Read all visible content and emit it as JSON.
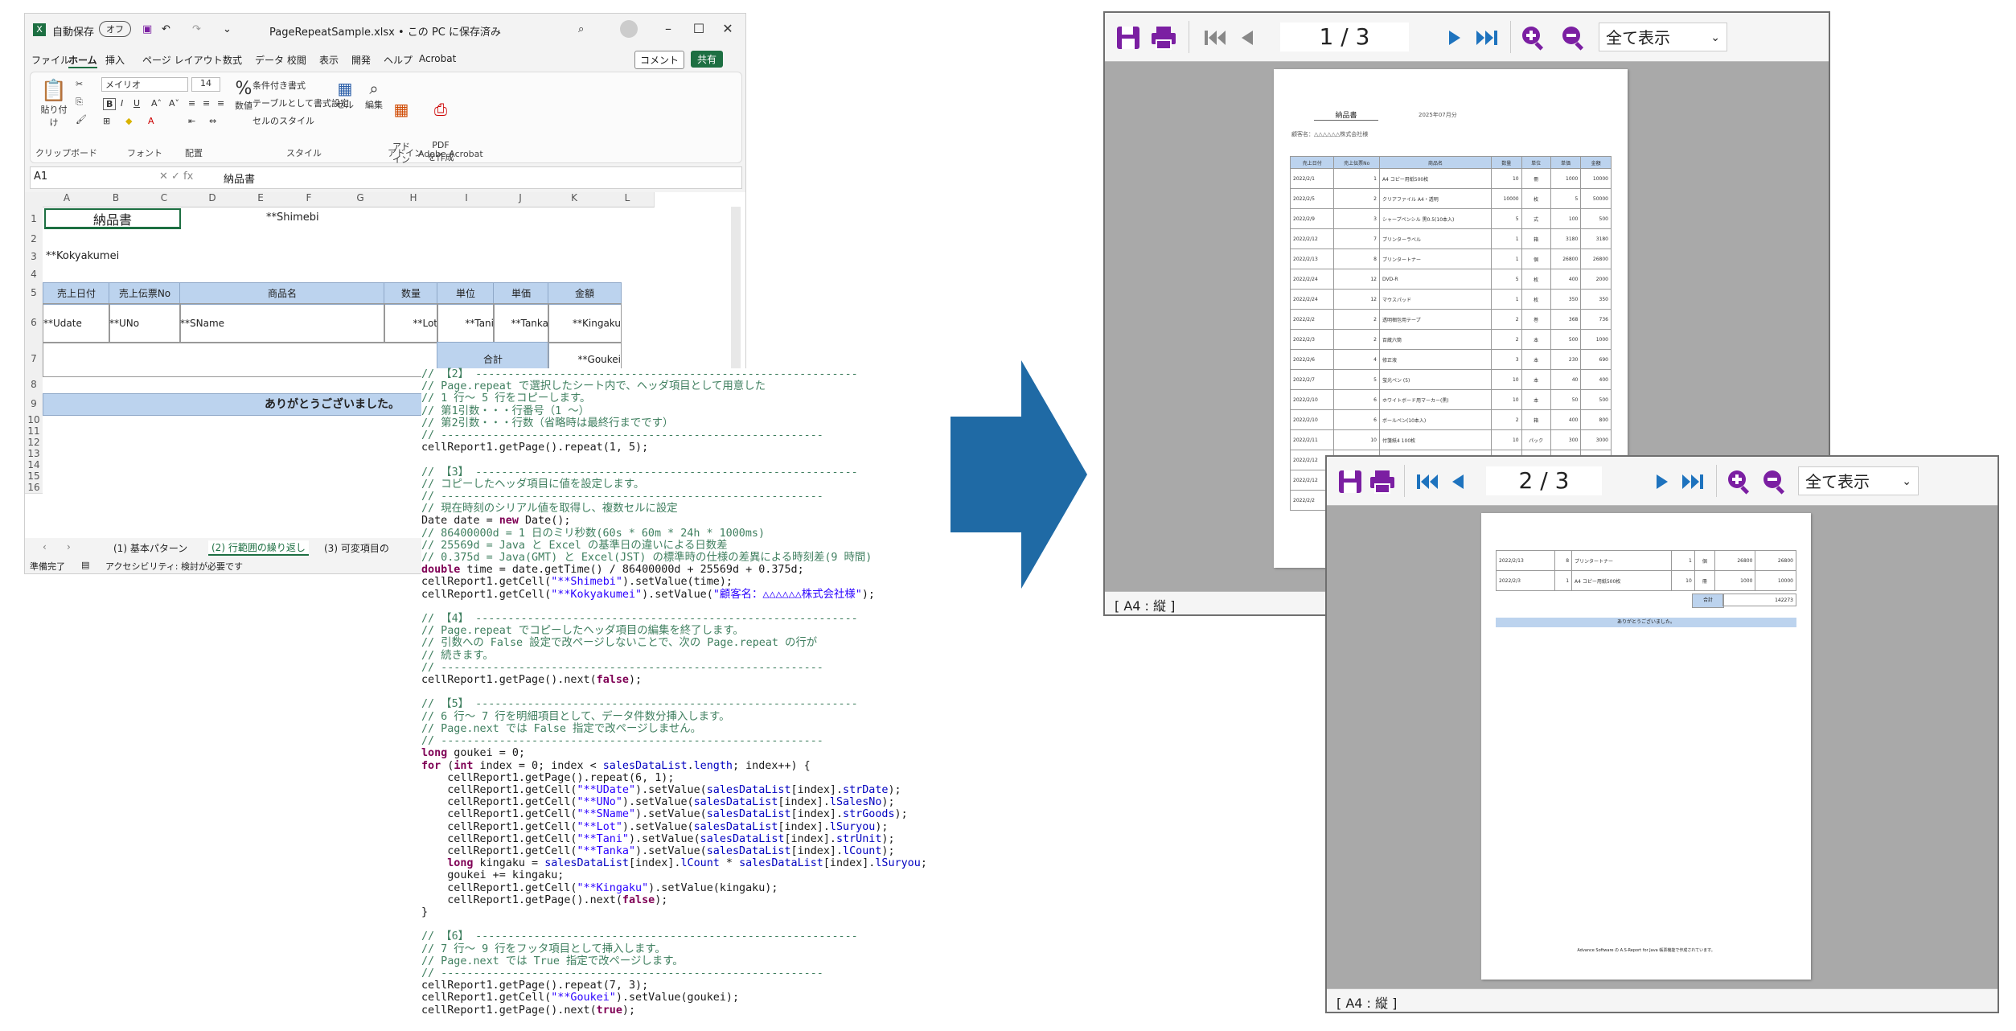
{
  "excel": {
    "autosave_label": "自動保存",
    "autosave_state": "オフ",
    "filename": "PageRepeatSample.xlsx • この PC に保存済み",
    "menu": [
      "ファイル",
      "ホーム",
      "挿入",
      "ページ レイアウト",
      "数式",
      "データ",
      "校閲",
      "表示",
      "開発",
      "ヘルプ",
      "Acrobat"
    ],
    "comment_btn": "コメント",
    "share_btn": "共有",
    "ribbon": {
      "paste": "貼り付け",
      "clipboard": "クリップボード",
      "font_name": "メイリオ",
      "font_size": "14",
      "font": "フォント",
      "align": "配置",
      "percent": "%",
      "number": "数値",
      "cond_format": "条件付き書式",
      "table_format": "テーブルとして書式設定",
      "cell_style": "セルのスタイル",
      "style": "スタイル",
      "cells": "セル",
      "edit": "編集",
      "addin": "アド\nイン",
      "addin_grp": "アドイン",
      "pdf": "PDF\nを作成",
      "acrobat_grp": "Adobe Acrobat"
    },
    "namebox": "A1",
    "formula": "納品書",
    "columns": [
      "A",
      "B",
      "C",
      "D",
      "E",
      "F",
      "G",
      "H",
      "I",
      "J",
      "K",
      "L"
    ],
    "rows": [
      "1",
      "2",
      "3",
      "4",
      "5",
      "6",
      "7",
      "8",
      "9",
      "10",
      "11",
      "12",
      "13",
      "14",
      "15",
      "16"
    ],
    "cells": {
      "title": "納品書",
      "shimebi": "**Shimebi",
      "kokyakumei": "**Kokyakumei",
      "headers": [
        "売上日付",
        "売上伝票No",
        "商品名",
        "数量",
        "単位",
        "単価",
        "金額"
      ],
      "row6": [
        "**Udate",
        "**UNo",
        "**SName",
        "**Lot",
        "**Tani",
        "**Tanka",
        "**Kingaku"
      ],
      "total_label": "合計",
      "goukei": "**Goukei",
      "thanks": "ありがとうございました。"
    },
    "sheet_tabs": [
      "(1) 基本パターン",
      "(2) 行範囲の繰り返し",
      "(3) 可変項目の"
    ],
    "active_tab": 1,
    "status_ready": "準備完了",
    "status_access": "アクセシビリティ: 検討が必要です"
  },
  "code_lines": [
    [
      [
        "cm",
        "// 【2】 -----------------------------------------------------------"
      ]
    ],
    [
      [
        "cm",
        "// Page.repeat で選択したシート内で、ヘッダ項目として用意した"
      ]
    ],
    [
      [
        "cm",
        "// 1 行～ 5 行をコピーします。"
      ]
    ],
    [
      [
        "cm",
        "// 第1引数・・・行番号（1 ～）"
      ]
    ],
    [
      [
        "cm",
        "// 第2引数・・・行数（省略時は最終行までです）"
      ]
    ],
    [
      [
        "cm",
        "// -----------------------------------------------------------"
      ]
    ],
    [
      [
        "pl",
        "cellReport1.getPage().repeat(1, 5);"
      ]
    ],
    [
      [
        "pl",
        ""
      ]
    ],
    [
      [
        "cm",
        "// 【3】 -----------------------------------------------------------"
      ]
    ],
    [
      [
        "cm",
        "// コピーしたヘッダ項目に値を設定します。"
      ]
    ],
    [
      [
        "cm",
        "// -----------------------------------------------------------"
      ]
    ],
    [
      [
        "cm",
        "// 現在時刻のシリアル値を取得し、複数セルに設定"
      ]
    ],
    [
      [
        "pl",
        "Date date = "
      ],
      [
        "kw",
        "new"
      ],
      [
        "pl",
        " Date();"
      ]
    ],
    [
      [
        "cm",
        "// 86400000d = 1 日のミリ秒数(60s * 60m * 24h * 1000ms)"
      ]
    ],
    [
      [
        "cm",
        "// 25569d = Java と Excel の基準日の違いによる日数差"
      ]
    ],
    [
      [
        "cm",
        "// 0.375d = Java(GMT) と Excel(JST) の標準時の仕様の差異による時刻差(9 時間)"
      ]
    ],
    [
      [
        "kw",
        "double"
      ],
      [
        "pl",
        " time = date.getTime() / 86400000d + 25569d + 0.375d;"
      ]
    ],
    [
      [
        "pl",
        "cellReport1.getCell("
      ],
      [
        "st",
        "\"**Shimebi\""
      ],
      [
        "pl",
        ").setValue(time);"
      ]
    ],
    [
      [
        "pl",
        "cellReport1.getCell("
      ],
      [
        "st",
        "\"**Kokyakumei\""
      ],
      [
        "pl",
        ").setValue("
      ],
      [
        "st",
        "\"顧客名：△△△△△△株式会社様\""
      ],
      [
        "pl",
        ");"
      ]
    ],
    [
      [
        "pl",
        ""
      ]
    ],
    [
      [
        "cm",
        "// 【4】 -----------------------------------------------------------"
      ]
    ],
    [
      [
        "cm",
        "// Page.repeat でコピーしたヘッダ項目の編集を終了します。"
      ]
    ],
    [
      [
        "cm",
        "// 引数への False 設定で改ページしないことで、次の Page.repeat の行が"
      ]
    ],
    [
      [
        "cm",
        "// 続きます。"
      ]
    ],
    [
      [
        "cm",
        "// -----------------------------------------------------------"
      ]
    ],
    [
      [
        "pl",
        "cellReport1.getPage().next("
      ],
      [
        "kw",
        "false"
      ],
      [
        "pl",
        ");"
      ]
    ],
    [
      [
        "pl",
        ""
      ]
    ],
    [
      [
        "cm",
        "// 【5】 -----------------------------------------------------------"
      ]
    ],
    [
      [
        "cm",
        "// 6 行～ 7 行を明細項目として、データ件数分挿入します。"
      ]
    ],
    [
      [
        "cm",
        "// Page.next では False 指定で改ページしません。"
      ]
    ],
    [
      [
        "cm",
        "// -----------------------------------------------------------"
      ]
    ],
    [
      [
        "kw",
        "long"
      ],
      [
        "pl",
        " goukei = 0;"
      ]
    ],
    [
      [
        "kw",
        "for"
      ],
      [
        "pl",
        " ("
      ],
      [
        "kw",
        "int"
      ],
      [
        "pl",
        " index = 0; index < "
      ],
      [
        "vr",
        "salesDataList"
      ],
      [
        "pl",
        "."
      ],
      [
        "vr",
        "length"
      ],
      [
        "pl",
        "; index++) {"
      ]
    ],
    [
      [
        "pl",
        "    cellReport1.getPage().repeat(6, 1);"
      ]
    ],
    [
      [
        "pl",
        "    cellReport1.getCell("
      ],
      [
        "st",
        "\"**UDate\""
      ],
      [
        "pl",
        ").setValue("
      ],
      [
        "vr",
        "salesDataList"
      ],
      [
        "pl",
        "[index]."
      ],
      [
        "vr",
        "strDate"
      ],
      [
        "pl",
        ");"
      ]
    ],
    [
      [
        "pl",
        "    cellReport1.getCell("
      ],
      [
        "st",
        "\"**UNo\""
      ],
      [
        "pl",
        ").setValue("
      ],
      [
        "vr",
        "salesDataList"
      ],
      [
        "pl",
        "[index]."
      ],
      [
        "vr",
        "lSalesNo"
      ],
      [
        "pl",
        ");"
      ]
    ],
    [
      [
        "pl",
        "    cellReport1.getCell("
      ],
      [
        "st",
        "\"**SName\""
      ],
      [
        "pl",
        ").setValue("
      ],
      [
        "vr",
        "salesDataList"
      ],
      [
        "pl",
        "[index]."
      ],
      [
        "vr",
        "strGoods"
      ],
      [
        "pl",
        ");"
      ]
    ],
    [
      [
        "pl",
        "    cellReport1.getCell("
      ],
      [
        "st",
        "\"**Lot\""
      ],
      [
        "pl",
        ").setValue("
      ],
      [
        "vr",
        "salesDataList"
      ],
      [
        "pl",
        "[index]."
      ],
      [
        "vr",
        "lSuryou"
      ],
      [
        "pl",
        ");"
      ]
    ],
    [
      [
        "pl",
        "    cellReport1.getCell("
      ],
      [
        "st",
        "\"**Tani\""
      ],
      [
        "pl",
        ").setValue("
      ],
      [
        "vr",
        "salesDataList"
      ],
      [
        "pl",
        "[index]."
      ],
      [
        "vr",
        "strUnit"
      ],
      [
        "pl",
        ");"
      ]
    ],
    [
      [
        "pl",
        "    cellReport1.getCell("
      ],
      [
        "st",
        "\"**Tanka\""
      ],
      [
        "pl",
        ").setValue("
      ],
      [
        "vr",
        "salesDataList"
      ],
      [
        "pl",
        "[index]."
      ],
      [
        "vr",
        "lCount"
      ],
      [
        "pl",
        ");"
      ]
    ],
    [
      [
        "pl",
        "    "
      ],
      [
        "kw",
        "long"
      ],
      [
        "pl",
        " kingaku = "
      ],
      [
        "vr",
        "salesDataList"
      ],
      [
        "pl",
        "[index]."
      ],
      [
        "vr",
        "lCount"
      ],
      [
        "pl",
        " * "
      ],
      [
        "vr",
        "salesDataList"
      ],
      [
        "pl",
        "[index]."
      ],
      [
        "vr",
        "lSuryou"
      ],
      [
        "pl",
        ";"
      ]
    ],
    [
      [
        "pl",
        "    goukei += kingaku;"
      ]
    ],
    [
      [
        "pl",
        "    cellReport1.getCell("
      ],
      [
        "st",
        "\"**Kingaku\""
      ],
      [
        "pl",
        ").setValue(kingaku);"
      ]
    ],
    [
      [
        "pl",
        "    cellReport1.getPage().next("
      ],
      [
        "kw",
        "false"
      ],
      [
        "pl",
        ");"
      ]
    ],
    [
      [
        "pl",
        "}"
      ]
    ],
    [
      [
        "pl",
        ""
      ]
    ],
    [
      [
        "cm",
        "// 【6】 -----------------------------------------------------------"
      ]
    ],
    [
      [
        "cm",
        "// 7 行～ 9 行をフッタ項目として挿入します。"
      ]
    ],
    [
      [
        "cm",
        "// Page.next では True 指定で改ページします。"
      ]
    ],
    [
      [
        "cm",
        "// -----------------------------------------------------------"
      ]
    ],
    [
      [
        "pl",
        "cellReport1.getPage().repeat(7, 3);"
      ]
    ],
    [
      [
        "pl",
        "cellReport1.getCell("
      ],
      [
        "st",
        "\"**Goukei\""
      ],
      [
        "pl",
        ").setValue(goukei);"
      ]
    ],
    [
      [
        "pl",
        "cellReport1.getPage().next("
      ],
      [
        "kw",
        "true"
      ],
      [
        "pl",
        ");"
      ]
    ]
  ],
  "viewer1": {
    "page_current": "1",
    "page_total": "/ 3",
    "zoom": "全て表示",
    "footer": "[ A4 : 縦 ]",
    "doc_title": "納品書",
    "doc_date": "2025年07月分",
    "doc_customer": "顧客名：△△△△△△株式会社様",
    "table_headers": [
      "売上日付",
      "売上伝票No",
      "商品名",
      "数量",
      "単位",
      "単価",
      "金額"
    ],
    "rows": [
      [
        "2022/2/1",
        "1",
        "A4 コピー用紙500枚",
        "10",
        "冊",
        "1000",
        "10000"
      ],
      [
        "2022/2/5",
        "2",
        "クリアファイル A4・透明",
        "10000",
        "枚",
        "5",
        "50000"
      ],
      [
        "2022/2/9",
        "3",
        "シャープペンシル 黒0.5(10本入)",
        "5",
        "式",
        "100",
        "500"
      ],
      [
        "2022/2/12",
        "7",
        "プリンターラベル",
        "1",
        "箱",
        "3180",
        "3180"
      ],
      [
        "2022/2/13",
        "8",
        "プリンタートナー",
        "1",
        "個",
        "26800",
        "26800"
      ],
      [
        "2022/2/24",
        "12",
        "DVD-R",
        "5",
        "枚",
        "400",
        "2000"
      ],
      [
        "2022/2/24",
        "12",
        "マウスパッド",
        "1",
        "枚",
        "350",
        "350"
      ],
      [
        "2022/2/2",
        "2",
        "透明梱包用テープ",
        "2",
        "巻",
        "368",
        "736"
      ],
      [
        "2022/2/3",
        "2",
        "百蔵六筒",
        "2",
        "本",
        "500",
        "1000"
      ],
      [
        "2022/2/6",
        "4",
        "修正液",
        "3",
        "本",
        "230",
        "690"
      ],
      [
        "2022/2/7",
        "5",
        "蛍光ペン (5)",
        "10",
        "本",
        "40",
        "400"
      ],
      [
        "2022/2/10",
        "6",
        "ホワイトボード用マーカー(黒)",
        "10",
        "本",
        "50",
        "500"
      ],
      [
        "2022/2/10",
        "6",
        "ボールペン(10本入)",
        "2",
        "箱",
        "400",
        "800"
      ],
      [
        "2022/2/11",
        "10",
        "付箋紙4 100枚",
        "10",
        "パック",
        "300",
        "3000"
      ],
      [
        "2022/2/12",
        "",
        "",
        "",
        "",
        "",
        ""
      ],
      [
        "2022/2/12",
        "",
        "",
        "",
        "",
        "",
        ""
      ],
      [
        "2022/2/2",
        "",
        "",
        "",
        "",
        "",
        ""
      ]
    ]
  },
  "viewer2": {
    "page_current": "2",
    "page_total": "/ 3",
    "zoom": "全て表示",
    "footer": "[ A4 : 縦 ]",
    "rows": [
      [
        "2022/2/13",
        "8",
        "プリンタートナー",
        "1",
        "個",
        "26800",
        "26800"
      ],
      [
        "2022/2/3",
        "1",
        "A4 コピー用紙500枚",
        "10",
        "冊",
        "1000",
        "10000"
      ]
    ],
    "total_label": "合計",
    "total_value": "142273",
    "thanks": "ありがとうございました。",
    "credit": "Advance Software の A.S-Report for Java 帳票機能で作成されています。"
  },
  "colors": {
    "arrow": "#1f6aa5",
    "header_fill": "#bcd3ee",
    "toolbar_icon": "#7b1fa2",
    "nav_icon": "#1e73be"
  }
}
